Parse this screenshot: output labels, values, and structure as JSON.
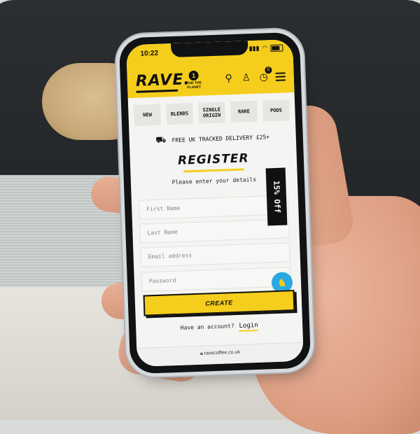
{
  "status_bar": {
    "time": "10:22"
  },
  "header": {
    "logo": "RAVE.",
    "planet_badge": "FOR THE PLANET",
    "cart_count": "0",
    "icons": [
      "search-icon",
      "account-icon",
      "cart-icon",
      "menu-icon"
    ]
  },
  "categories": [
    "NEW",
    "BLENDS",
    "SINGLE\nORIGIN",
    "RARE",
    "PODS"
  ],
  "delivery_banner": "FREE UK TRACKED DELIVERY £25+",
  "register": {
    "title": "REGISTER",
    "subtitle": "Please enter your details",
    "first_name_placeholder": "First Name",
    "last_name_placeholder": "Last Name",
    "email_placeholder": "Email address",
    "password_placeholder": "Password",
    "create_label": "CREATE",
    "account_prompt": "Have an account?",
    "login_label": "Login"
  },
  "promo_tab": "15% Off",
  "url": "ravecoffee.co.uk",
  "colors": {
    "brand_yellow": "#f5cd1d",
    "text": "#111111",
    "chat_blue": "#2aa8df"
  }
}
